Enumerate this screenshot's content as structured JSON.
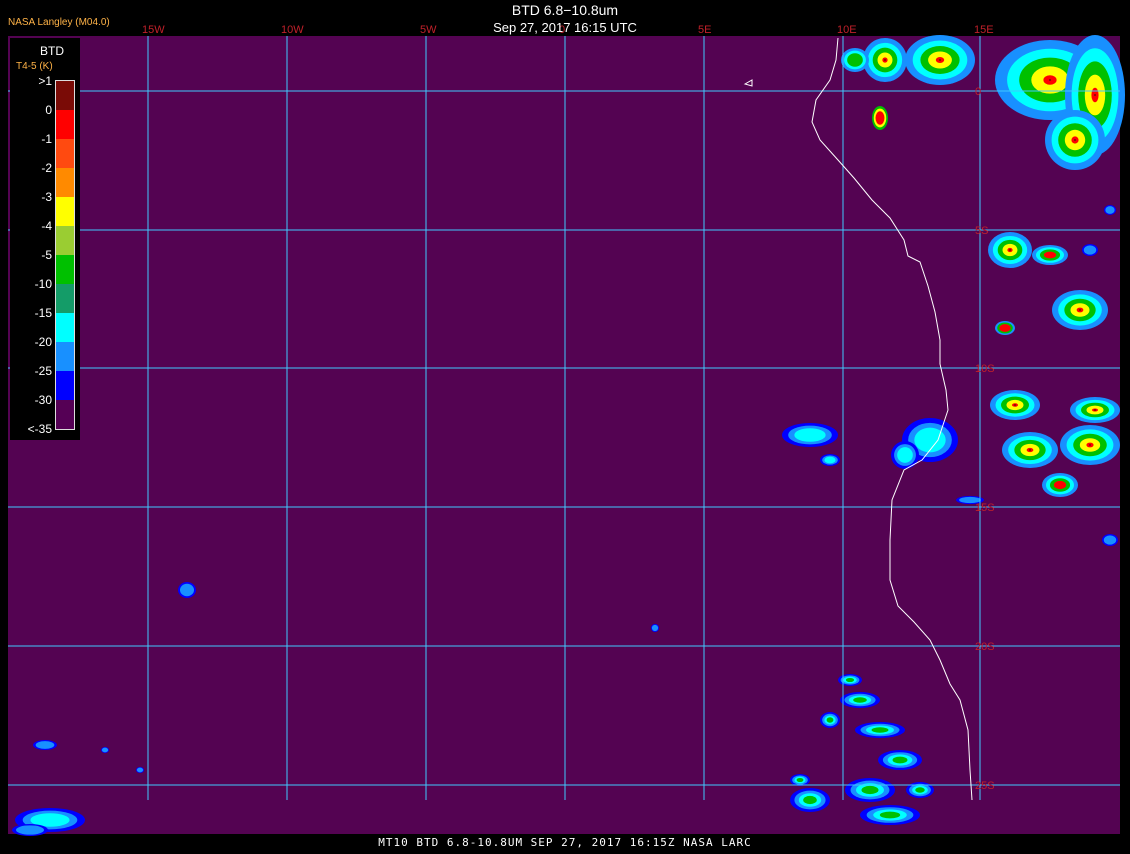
{
  "header": {
    "credit": "NASA Langley (M04.0)",
    "title_line1": "BTD 6.8−10.8um",
    "title_line2": "Sep 27, 2017 16:15 UTC"
  },
  "footer": "MT10  BTD 6.8-10.8UM   SEP 27, 2017 16:15Z   NASA LARC",
  "legend": {
    "title": "BTD",
    "units": "T4-5 (K)",
    "items": [
      {
        "label": ">1",
        "color": "#7a0b06"
      },
      {
        "label": "0",
        "color": "#ff0000"
      },
      {
        "label": "-1",
        "color": "#ff4a10"
      },
      {
        "label": "-2",
        "color": "#ff8a00"
      },
      {
        "label": "-3",
        "color": "#ffff00"
      },
      {
        "label": "-4",
        "color": "#9acd32"
      },
      {
        "label": "-5",
        "color": "#00c000"
      },
      {
        "label": "-10",
        "color": "#149c68"
      },
      {
        "label": "-15",
        "color": "#00ffff"
      },
      {
        "label": "-20",
        "color": "#1890ff"
      },
      {
        "label": "-25",
        "color": "#0000ff"
      },
      {
        "label": "-30",
        "color": "#550055"
      },
      {
        "label": "<-35",
        "color": ""
      }
    ]
  },
  "map": {
    "background_color": "#540352",
    "grid_color": "#40c8ff",
    "coast_color": "#ffffff",
    "lon_labels": [
      "15W",
      "10W",
      "5W",
      "0",
      "5E",
      "10E",
      "15E"
    ],
    "lat_labels": [
      "0",
      "5S",
      "10S",
      "15S",
      "20S",
      "25S"
    ],
    "label_color": "#c0202a"
  }
}
